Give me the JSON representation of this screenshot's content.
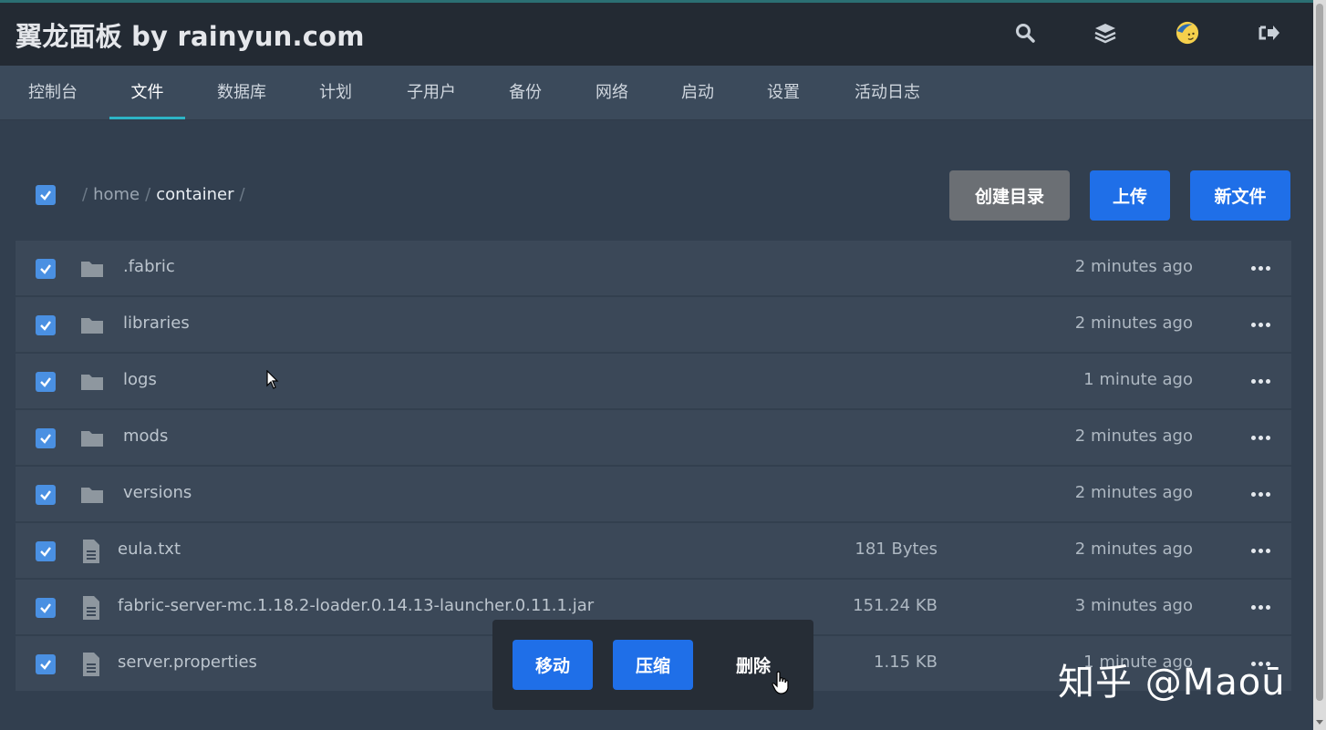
{
  "app": {
    "title": "翼龙面板 by rainyun.com"
  },
  "header_icons": [
    "search-icon",
    "layers-icon",
    "avatar-icon",
    "logout-icon"
  ],
  "nav": {
    "items": [
      {
        "label": "控制台",
        "active": false
      },
      {
        "label": "文件",
        "active": true
      },
      {
        "label": "数据库",
        "active": false
      },
      {
        "label": "计划",
        "active": false
      },
      {
        "label": "子用户",
        "active": false
      },
      {
        "label": "备份",
        "active": false
      },
      {
        "label": "网络",
        "active": false
      },
      {
        "label": "启动",
        "active": false
      },
      {
        "label": "设置",
        "active": false
      },
      {
        "label": "活动日志",
        "active": false
      }
    ]
  },
  "breadcrumb": {
    "parts": [
      "home",
      "container"
    ],
    "separator": "/"
  },
  "toolbar": {
    "create_dir_label": "创建目录",
    "upload_label": "上传",
    "new_file_label": "新文件"
  },
  "files": [
    {
      "name": ".fabric",
      "type": "folder",
      "size": "",
      "modified": "2 minutes ago",
      "checked": true
    },
    {
      "name": "libraries",
      "type": "folder",
      "size": "",
      "modified": "2 minutes ago",
      "checked": true
    },
    {
      "name": "logs",
      "type": "folder",
      "size": "",
      "modified": "1 minute ago",
      "checked": true
    },
    {
      "name": "mods",
      "type": "folder",
      "size": "",
      "modified": "2 minutes ago",
      "checked": true
    },
    {
      "name": "versions",
      "type": "folder",
      "size": "",
      "modified": "2 minutes ago",
      "checked": true
    },
    {
      "name": "eula.txt",
      "type": "file",
      "size": "181 Bytes",
      "modified": "2 minutes ago",
      "checked": true
    },
    {
      "name": "fabric-server-mc.1.18.2-loader.0.14.13-launcher.0.11.1.jar",
      "type": "file",
      "size": "151.24 KB",
      "modified": "3 minutes ago",
      "checked": true
    },
    {
      "name": "server.properties",
      "type": "file",
      "size": "1.15 KB",
      "modified": "1 minute ago",
      "checked": true
    }
  ],
  "actions": {
    "move_label": "移动",
    "compress_label": "压缩",
    "delete_label": "删除"
  },
  "watermark": "知乎 @Maoū",
  "colors": {
    "header_bg": "#232a33",
    "nav_bg": "#3b4a5b",
    "page_bg": "#323f4f",
    "row_bg": "#3b4858",
    "accent_blue": "#1f6fe8",
    "checkbox_blue": "#4a90e2",
    "tab_underline": "#2db4c6"
  }
}
